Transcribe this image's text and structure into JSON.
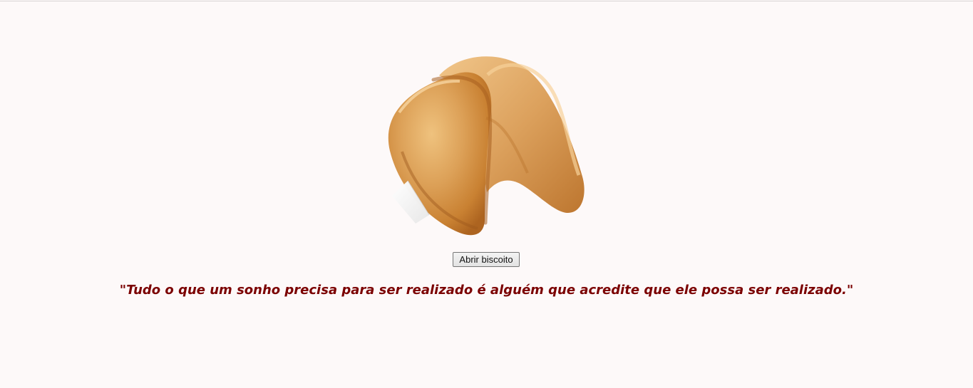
{
  "page": {
    "background_color": "#fdf9f9"
  },
  "image": {
    "icon": "fortune-cookie-image"
  },
  "button": {
    "label": "Abrir biscoito"
  },
  "message": {
    "text": "\"Tudo o que um sonho precisa para ser realizado é alguém que acredite que ele possa ser realizado.\"",
    "color": "#7b0000"
  }
}
